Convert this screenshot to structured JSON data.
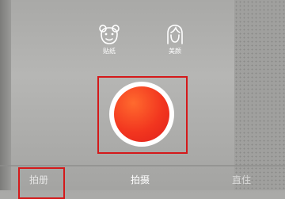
{
  "toolbar": {
    "stickers_label": "贴纸",
    "beauty_label": "美颜"
  },
  "shutter": {
    "color": "#f2361f"
  },
  "tabs": {
    "album": "拍册",
    "shoot": "拍摄",
    "third": "直住"
  },
  "colors": {
    "highlight": "#d4191a",
    "text": "#ffffff"
  }
}
